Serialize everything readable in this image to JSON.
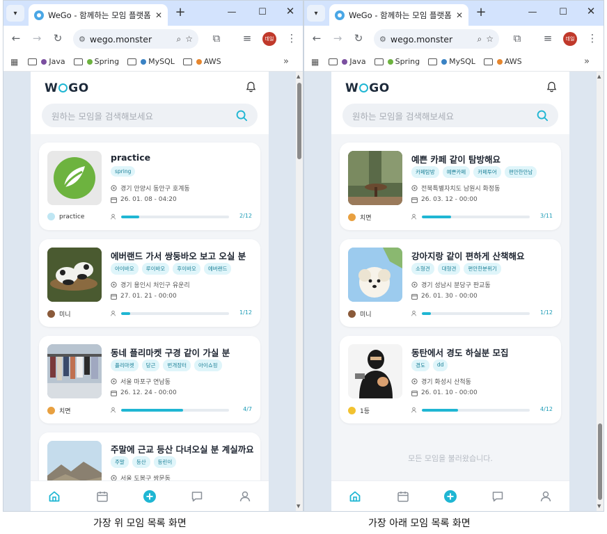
{
  "browser": {
    "tab_title": "WeGo - 함께하는 모임 플랫폼",
    "url": "wego.monster",
    "profile_label": "데일",
    "bookmarks": [
      "Java",
      "Spring",
      "MySQL",
      "AWS"
    ],
    "more": "»"
  },
  "app": {
    "logo_pre": "W",
    "logo_post": "GO",
    "search_placeholder": "원하는 모임을 검색해보세요",
    "end_message": "모든 모임을 불러왔습니다."
  },
  "left_cards": [
    {
      "title": "practice",
      "tags": [
        "spring"
      ],
      "location": "경기 안양시 동안구 호계동",
      "datetime": "26. 01. 08 - 04:20",
      "host": "practice",
      "count": "2/12",
      "progress": 0.167
    },
    {
      "title": "에버랜드 가서 쌍둥바오 보고 오실 분",
      "tags": [
        "아이바오",
        "루이바오",
        "후이바오",
        "에버랜드"
      ],
      "location": "경기 용인시 처인구 유운리",
      "datetime": "27. 01. 21 - 00:00",
      "host": "미니",
      "count": "1/12",
      "progress": 0.083
    },
    {
      "title": "동네 플리마켓 구경 같이 가실 분",
      "tags": [
        "플리마켓",
        "당근",
        "번개장터",
        "아이쇼핑"
      ],
      "location": "서울 마포구 연남동",
      "datetime": "26. 12. 24 - 00:00",
      "host": "치면",
      "count": "4/7",
      "progress": 0.571
    },
    {
      "title": "주말에 근교 등산 다녀오실 분 계실까요",
      "tags": [
        "주말",
        "등산",
        "등린이"
      ],
      "location": "서울 도봉구 쌍문동",
      "datetime": "",
      "host": "",
      "count": "",
      "progress": 0
    }
  ],
  "right_cards": [
    {
      "title": "예쁜 카페 같이 탐방해요",
      "tags": [
        "카페탐방",
        "예쁜카페",
        "카페투어",
        "편안한안남"
      ],
      "location": "전북특별자치도 남원시 화정동",
      "datetime": "26. 03. 12 - 00:00",
      "host": "치면",
      "count": "3/11",
      "progress": 0.273
    },
    {
      "title": "강아지랑 같이 편하게 산책해요",
      "tags": [
        "소형견",
        "대형견",
        "편안한분위기"
      ],
      "location": "경기 성남시 분당구 판교동",
      "datetime": "26. 01. 30 - 00:00",
      "host": "미니",
      "count": "1/12",
      "progress": 0.083
    },
    {
      "title": "동탄에서 경도 하실분 모집",
      "tags": [
        "경도",
        "dd"
      ],
      "location": "경기 화성시 산척동",
      "datetime": "26. 01. 10 - 00:00",
      "host": "1등",
      "count": "4/12",
      "progress": 0.333
    }
  ],
  "captions": {
    "left": "가장 위 모임 목록 화면",
    "right": "가장 아래 모임 목록 화면"
  },
  "colors": {
    "accent": "#1fb6d3",
    "page_bg": "#dde6f0",
    "tab_strip": "#d3e3fd"
  }
}
